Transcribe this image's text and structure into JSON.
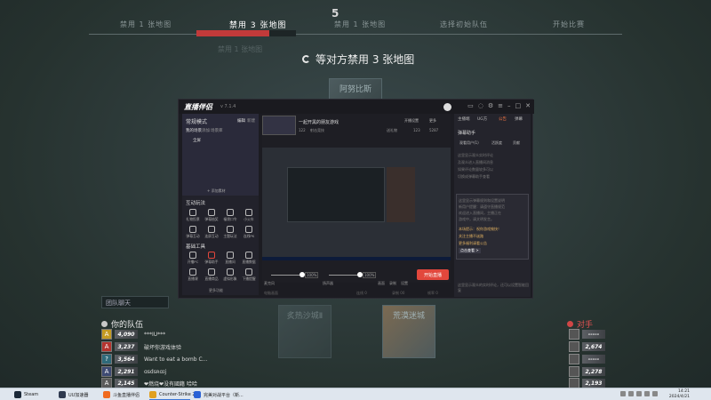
{
  "stages": {
    "step_number": "5",
    "items": [
      "禁用 1 张地图",
      "禁用 3 张地图",
      "禁用 1 张地图",
      "选择初始队伍",
      "开始比赛"
    ],
    "active_index": 1,
    "progress": 0.73,
    "ghost_text": "禁用 1 张地图"
  },
  "status": {
    "waiting_text": "等对方禁用 3 张地图"
  },
  "maps": {
    "top_tile": "阿努比斯",
    "bottom_left": "炙热沙城Ⅱ",
    "bottom_right": "荒漠迷城"
  },
  "app": {
    "logo": "直播伴侣",
    "version": "v 7.1.4",
    "left": {
      "scene_title": "常规模式",
      "scene_links": [
        "编辑",
        "新建"
      ],
      "scene_tabs": [
        "我的场景",
        "添加",
        "场景库"
      ],
      "scene_item": "全屏",
      "add_material": "+ 添加素材",
      "interaction_title": "互动玩法",
      "interaction_tools": [
        "礼物投票",
        "弹幕抽奖",
        "福袋口令",
        "小火车"
      ],
      "interaction_tools2": [
        "弹幕互动",
        "连屏互动",
        "主题玩法",
        "连线PK"
      ],
      "basic_title": "基础工具",
      "basic_tools": [
        "开播PC",
        "弹幕助手",
        "直播间",
        "直播数据"
      ],
      "basic_tools2": [
        "直播课",
        "直播商品",
        "虚拟形象",
        "下播提醒"
      ],
      "more": "更多功能"
    },
    "center": {
      "stream_title": "一起开黑的朋友游戏",
      "tags": [
        "122",
        "射击竞技"
      ],
      "top_right": [
        "开播设置",
        "更多"
      ],
      "stats": [
        "送礼物",
        "123",
        "5287"
      ],
      "mic_pct": "100%",
      "sys_pct": "100%",
      "mic_label": "麦克风",
      "sys_label": "扬声器",
      "ctl_labels": [
        "画面",
        "录制",
        "设置"
      ],
      "go_live": "开始直播",
      "footer": [
        "电脑画面",
        "连线 0",
        "录制 00",
        "帧率 0"
      ]
    },
    "right": {
      "tabs": [
        "主播端",
        "UG方",
        "公告",
        "弹幕"
      ],
      "active_tab": "公告",
      "sub_header": "弹幕助手",
      "sub_tabs": [
        "观看用户(1)",
        "活跃度",
        "贡献"
      ],
      "lines": [
        "这里显示观众实时评论",
        "及观众进入直播间消息",
        "如果评论数量较多可以",
        "切换成弹幕助手查看"
      ],
      "notice": [
        "这里显示弹幕规则和设置说明",
        "新用户提醒：请遵守直播规范",
        "欢迎进入直播间，主播正在",
        "游戏中，请文明发言。"
      ],
      "highlight": [
        "本场提示：祝你游戏愉快！",
        "关注主播不迷路",
        "更多福利请看公告",
        "点击查看 >"
      ],
      "bottom": "这里显示观众的实时评论，还可以设置智能回复"
    }
  },
  "team": {
    "chat_label": "团队聊天",
    "title": "你的队伍",
    "players": [
      {
        "avatar": "A",
        "rank": "4,090",
        "name": "***IU***"
      },
      {
        "avatar": "A",
        "rank": "3,237",
        "name": "破坏你游戏体验"
      },
      {
        "avatar": "?",
        "rank": "3,564",
        "name": "Want to eat a bomb C..."
      },
      {
        "avatar": "A",
        "rank": "2,291",
        "name": "ɑsdsʀɑɪj"
      },
      {
        "avatar": "A",
        "rank": "2,145",
        "name": "❤燃烧❤没有國籍 哈哈"
      }
    ]
  },
  "enemy": {
    "title": "对手",
    "players": [
      {
        "rank": "-----"
      },
      {
        "rank": "2,674"
      },
      {
        "rank": "-----"
      },
      {
        "rank": "2,278"
      },
      {
        "rank": "2,193"
      }
    ]
  },
  "taskbar": {
    "apps": [
      "Steam",
      "UU加速器",
      "斗鱼直播伴侣",
      "Counter-Strike 2",
      "完美对战平台（新..."
    ],
    "time": "14:21",
    "date": "2024/4/21"
  },
  "colors": {
    "accent_red": "#c23a3a",
    "go_live": "#e2473c",
    "enemy_red": "#e65252"
  }
}
